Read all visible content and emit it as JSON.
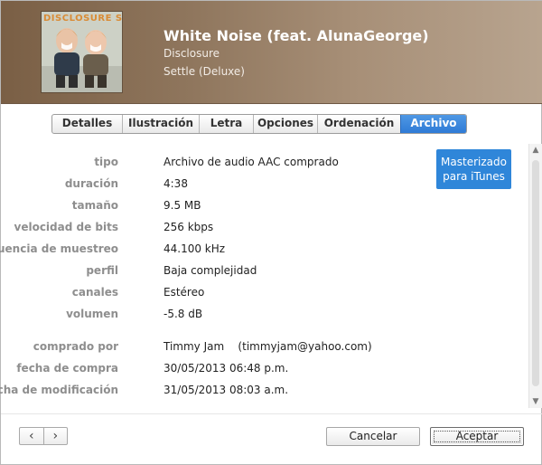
{
  "song": {
    "title": "White Noise (feat. AlunaGeorge)",
    "artist": "Disclosure",
    "album": "Settle (Deluxe)",
    "artwork_text": "DISCLOSURE SETTLE"
  },
  "tabs": [
    {
      "label": "Detalles",
      "active": false
    },
    {
      "label": "Ilustración",
      "active": false
    },
    {
      "label": "Letra",
      "active": false
    },
    {
      "label": "Opciones",
      "active": false
    },
    {
      "label": "Ordenación",
      "active": false
    },
    {
      "label": "Archivo",
      "active": true
    }
  ],
  "file_info": {
    "rows": [
      {
        "label": "tipo",
        "value": "Archivo de audio AAC comprado"
      },
      {
        "label": "duración",
        "value": "4:38"
      },
      {
        "label": "tamaño",
        "value": "9.5 MB"
      },
      {
        "label": "velocidad de bits",
        "value": "256 kbps"
      },
      {
        "label": "frecuencia de muestreo",
        "value": "44.100 kHz"
      },
      {
        "label": "perfil",
        "value": "Baja complejidad"
      },
      {
        "label": "canales",
        "value": "Estéreo"
      },
      {
        "label": "volumen",
        "value": "-5.8 dB"
      },
      {
        "label": "comprado por",
        "value": "Timmy Jam    (timmyjam@yahoo.com)"
      },
      {
        "label": "fecha de compra",
        "value": "30/05/2013 06:48 p.m."
      },
      {
        "label": "fecha de modificación",
        "value": "31/05/2013 08:03 a.m."
      }
    ],
    "badge_line1": "Masterizado",
    "badge_line2": "para iTunes"
  },
  "nav": {
    "prev": "‹",
    "next": "›"
  },
  "buttons": {
    "cancel": "Cancelar",
    "ok": "Aceptar"
  },
  "colors": {
    "accent": "#2f7bd6",
    "header_bg": "#8f765d",
    "label": "#8e8e8e"
  },
  "icons": {
    "prev": "chevron-left-icon",
    "next": "chevron-right-icon",
    "scroll_up": "arrow-up-icon",
    "scroll_down": "arrow-down-icon"
  }
}
